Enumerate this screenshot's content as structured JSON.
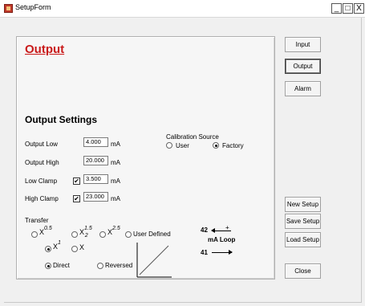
{
  "window": {
    "title": "SetupForm",
    "min": "_",
    "max": "□",
    "close": "X"
  },
  "page": {
    "title": "Output",
    "section_title": "Output Settings"
  },
  "fields": {
    "output_low": {
      "label": "Output Low",
      "value": "4.000",
      "unit": "mA"
    },
    "output_high": {
      "label": "Output High",
      "value": "20.000",
      "unit": "mA"
    },
    "low_clamp": {
      "label": "Low Clamp",
      "value": "3.500",
      "unit": "mA",
      "checked": true,
      "check_glyph": "✔"
    },
    "high_clamp": {
      "label": "High Clamp",
      "value": "23.000",
      "unit": "mA",
      "checked": true,
      "check_glyph": "✔"
    }
  },
  "calibration": {
    "title": "Calibration Source",
    "options": [
      {
        "label": "User",
        "selected": false
      },
      {
        "label": "Factory",
        "selected": true
      }
    ]
  },
  "transfer": {
    "title": "Transfer",
    "x_base": "X",
    "exp_05": "0.5",
    "exp_15": "1.5",
    "sub_15": "2",
    "exp_25": "2.5",
    "exp_1": "1",
    "user_defined": "User Defined",
    "selected": "x1",
    "direction": {
      "direct": "Direct",
      "reversed": "Reversed",
      "selected": "direct"
    }
  },
  "loop": {
    "top_num": "42",
    "sign": "+",
    "label": "mA Loop",
    "bottom_num": "41"
  },
  "nav_buttons": [
    {
      "label": "Input"
    },
    {
      "label": "Output",
      "active": true
    },
    {
      "label": "Alarm"
    }
  ],
  "setup_buttons": {
    "new": "New Setup",
    "save": "Save Setup",
    "load": "Load Setup",
    "close": "Close"
  }
}
